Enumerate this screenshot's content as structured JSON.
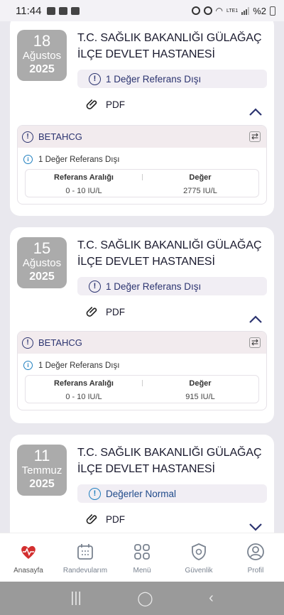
{
  "status_bar": {
    "time": "11:44",
    "battery": "%2",
    "network": "LTE1"
  },
  "records": [
    {
      "day": "18",
      "month": "Ağustos",
      "year": "2025",
      "hospital": "T.C. SAĞLIK BAKANLIĞI GÜLAĞAÇ İLÇE DEVLET HASTANESİ",
      "status": "1 Değer Referans Dışı",
      "pdf_label": "PDF",
      "expanded": true,
      "test": {
        "name": "BETAHCG",
        "note": "1 Değer Referans Dışı",
        "ref_header": "Referans Aralığı",
        "value_header": "Değer",
        "ref_value": "0 - 10 IU/L",
        "value": "2775 IU/L"
      }
    },
    {
      "day": "15",
      "month": "Ağustos",
      "year": "2025",
      "hospital": "T.C. SAĞLIK BAKANLIĞI GÜLAĞAÇ İLÇE DEVLET HASTANESİ",
      "status": "1 Değer Referans Dışı",
      "pdf_label": "PDF",
      "expanded": true,
      "test": {
        "name": "BETAHCG",
        "note": "1 Değer Referans Dışı",
        "ref_header": "Referans Aralığı",
        "value_header": "Değer",
        "ref_value": "0 - 10 IU/L",
        "value": "915 IU/L"
      }
    },
    {
      "day": "11",
      "month": "Temmuz",
      "year": "2025",
      "hospital": "T.C. SAĞLIK BAKANLIĞI GÜLAĞAÇ İLÇE DEVLET HASTANESİ",
      "status": "Değerler Normal",
      "pdf_label": "PDF",
      "expanded": false
    }
  ],
  "nav": [
    {
      "label": "Anasayfa",
      "icon": "heart-logo-icon"
    },
    {
      "label": "Randevularım",
      "icon": "calendar-icon"
    },
    {
      "label": "Menü",
      "icon": "grid-icon"
    },
    {
      "label": "Güvenlik",
      "icon": "shield-gear-icon"
    },
    {
      "label": "Profil",
      "icon": "user-icon"
    }
  ],
  "colors": {
    "accent": "#2c3470",
    "date_box": "#ababab",
    "nav_text": "#7a8390",
    "logo_red": "#d32f2f"
  }
}
